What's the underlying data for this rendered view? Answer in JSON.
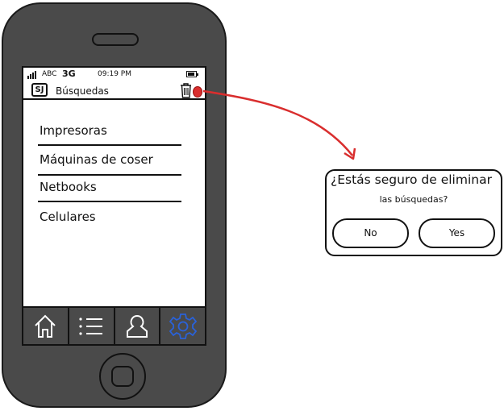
{
  "status_bar": {
    "carrier": "ABC",
    "network": "3G",
    "time": "09:19 PM"
  },
  "header": {
    "logo_text": "SJ",
    "title": "Búsquedas",
    "icons": [
      "app-logo-icon",
      "trash-icon"
    ]
  },
  "list": {
    "items": [
      "Impresoras",
      "Máquinas de coser",
      "Netbooks",
      "Celulares"
    ]
  },
  "tab_bar": {
    "icons": [
      "home-icon",
      "list-icon",
      "person-icon",
      "gear-icon"
    ],
    "active_index": 3,
    "active_color": "#2a62d9"
  },
  "dialog": {
    "title": "¿Estás seguro de eliminar",
    "subtitle": "las búsquedas?",
    "no_label": "No",
    "yes_label": "Yes"
  },
  "colors": {
    "phone_body": "#4a4a4a",
    "connector": "#d92e2e"
  }
}
